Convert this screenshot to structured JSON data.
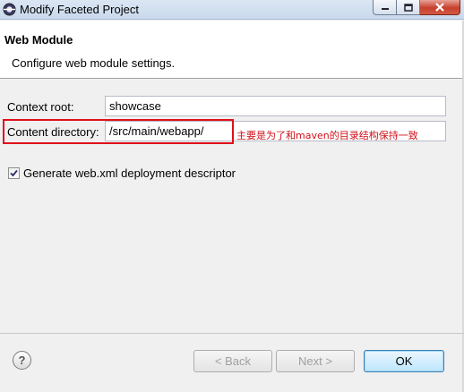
{
  "window": {
    "title": "Modify Faceted Project"
  },
  "header": {
    "title": "Web Module",
    "description": "Configure web module settings."
  },
  "form": {
    "context_root_label": "Context root:",
    "context_root_value": "showcase",
    "content_directory_label": "Content directory:",
    "content_directory_value": "/src/main/webapp/",
    "generate_descriptor_label": "Generate web.xml deployment descriptor",
    "generate_descriptor_checked": true
  },
  "annotation": {
    "text": "主要是为了和maven的目录结构保持一致",
    "color": "#d0101a"
  },
  "buttons": {
    "back": "< Back",
    "next": "Next >",
    "ok": "OK"
  },
  "icons": {
    "app": "eclipse-icon",
    "help": "help-icon",
    "minimize": "minimize-icon",
    "maximize": "maximize-icon",
    "close": "close-icon",
    "check": "checkmark-icon"
  }
}
